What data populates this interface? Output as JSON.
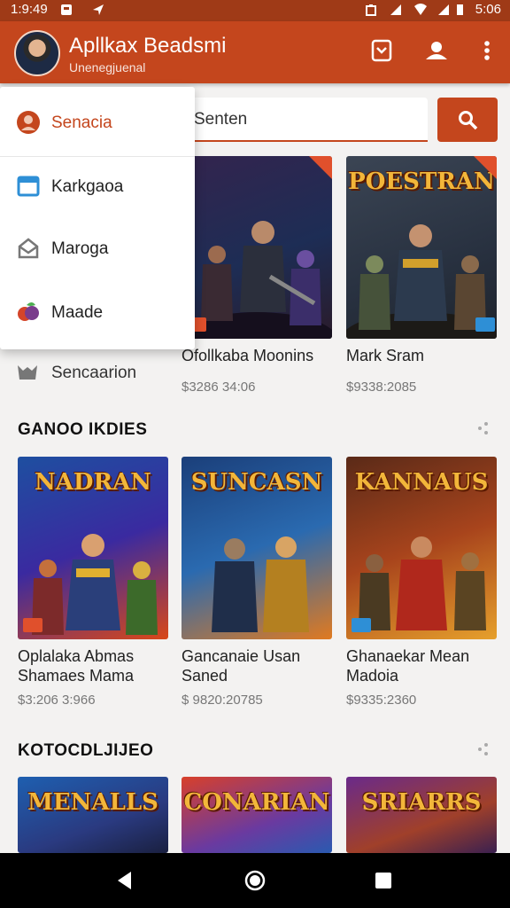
{
  "status": {
    "time": "1:9:49",
    "battery": "5:06"
  },
  "header": {
    "title": "Apllkax Beadsmi",
    "subtitle": "Unenegjuenal"
  },
  "search": {
    "placeholder": "Senten"
  },
  "menu": {
    "items": [
      {
        "label": "Senacia",
        "icon": "profile-icon"
      },
      {
        "label": "Karkgaoa",
        "icon": "window-icon"
      },
      {
        "label": "Maroga",
        "icon": "inbox-icon"
      },
      {
        "label": "Maade",
        "icon": "fruit-icon"
      }
    ]
  },
  "side_item": {
    "label": "Sencaarion"
  },
  "top_row": [
    {
      "name": "Ofollkaba Moonins",
      "price": "$3286 34:06"
    },
    {
      "name": "Mark Sram",
      "price": "$9338:2085",
      "title": "POESTRAN"
    }
  ],
  "sections": [
    {
      "title": "GANOO IKDIES",
      "cards": [
        {
          "title": "NADRAN",
          "name_line1": "Oplalaka Abmas",
          "name_line2": "Shamaes Mama",
          "price": "$3:206 3:966"
        },
        {
          "title": "SUNCASN",
          "name_line1": "Gancanaie Usan",
          "name_line2": "Saned",
          "price": "$ 9820:20785"
        },
        {
          "title": "KANNAUS",
          "name_line1": "Ghanaekar Mean",
          "name_line2": "Madoia",
          "price": "$9335:2360"
        }
      ]
    },
    {
      "title": "KOTOCDLJIJEO",
      "cards": [
        {
          "title": "MENALLS"
        },
        {
          "title": "CONARIAN"
        },
        {
          "title": "SRIARRS"
        }
      ]
    }
  ],
  "colors": {
    "accent": "#c4461d",
    "status_bar": "#9f3a17",
    "nav_bar": "#000000"
  }
}
